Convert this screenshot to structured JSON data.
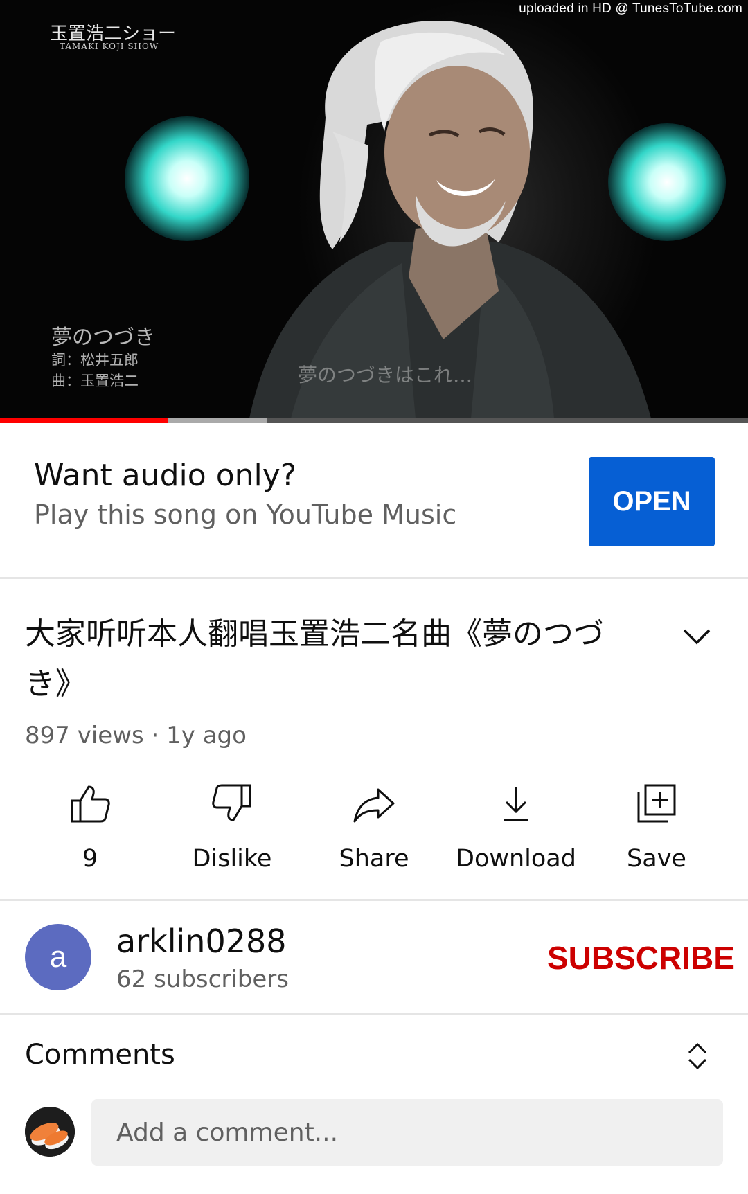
{
  "player": {
    "watermark": "uploaded in HD @ TunesToTube.com",
    "show_title": "玉置浩二ショー",
    "show_subtitle": "TAMAKI KOJI SHOW",
    "song_title": "夢のつづき",
    "credit_lyrics": "詞：松井五郎",
    "credit_music": "曲：玉置浩二",
    "lyric_caption": "夢のつづきはこれ…",
    "progress_played": 0.225,
    "progress_buffered": 0.357
  },
  "music_promo": {
    "title": "Want audio only?",
    "subtitle": "Play this song on YouTube Music",
    "open_label": "OPEN"
  },
  "video": {
    "title": "大家听听本人翻唱玉置浩二名曲《夢のつづき》",
    "meta": "897 views · 1y ago"
  },
  "actions": {
    "like_count": "9",
    "dislike_label": "Dislike",
    "share_label": "Share",
    "download_label": "Download",
    "save_label": "Save"
  },
  "channel": {
    "avatar_letter": "a",
    "name": "arklin0288",
    "subscribers": "62 subscribers",
    "subscribe_label": "SUBSCRIBE",
    "avatar_color": "#5c6bc0",
    "subscribe_color": "#cc0000"
  },
  "comments": {
    "title": "Comments",
    "placeholder": "Add a comment..."
  },
  "colors": {
    "open_button": "#065fd4",
    "progress_red": "#ff0000"
  }
}
